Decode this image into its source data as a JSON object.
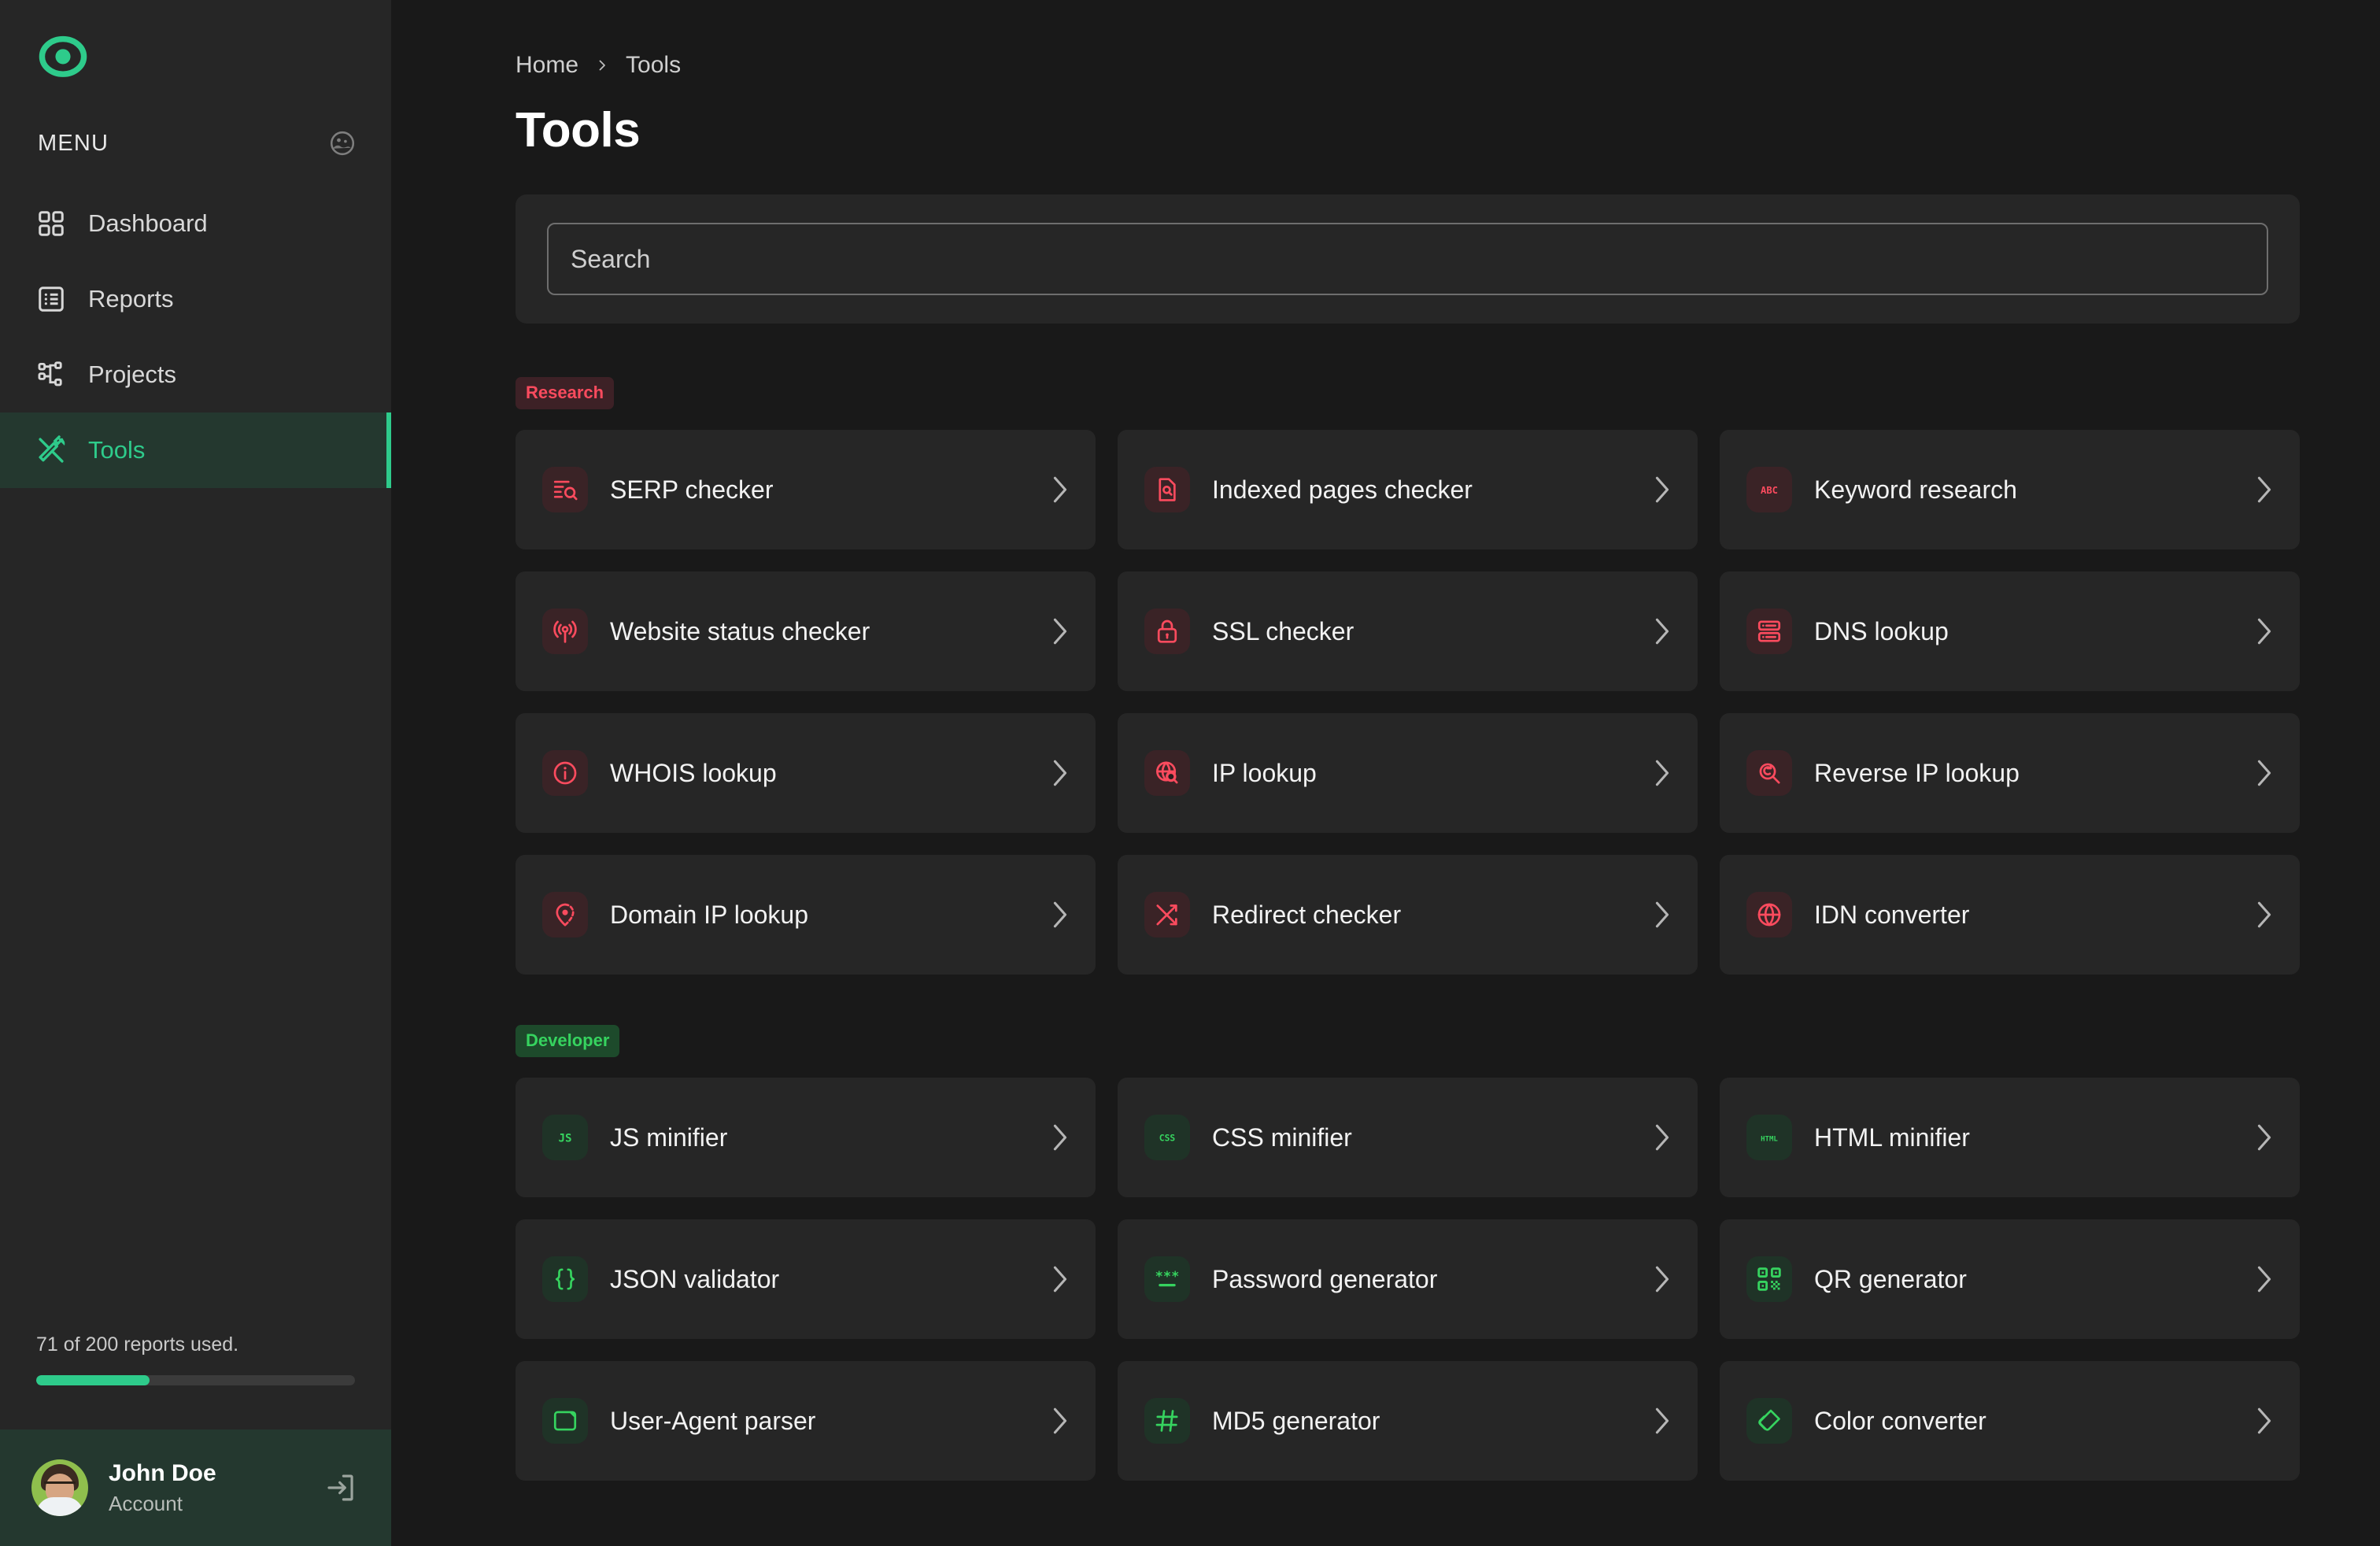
{
  "brand": {
    "logo_icon": "target-circle-logo"
  },
  "sidebar": {
    "menu_label": "MENU",
    "theme_icon": "color-palette-icon",
    "items": [
      {
        "label": "Dashboard",
        "icon": "grid-dashboard-icon",
        "active": false
      },
      {
        "label": "Reports",
        "icon": "list-report-icon",
        "active": false
      },
      {
        "label": "Projects",
        "icon": "sitemap-projects-icon",
        "active": false
      },
      {
        "label": "Tools",
        "icon": "hammer-wrench-tools-icon",
        "active": true
      }
    ],
    "usage": {
      "text": "71 of 200 reports used.",
      "used": 71,
      "total": 200,
      "percent": 35.5,
      "fill_color": "#2ecb8b"
    },
    "account": {
      "name": "John Doe",
      "subtitle": "Account",
      "avatar_icon": "user-avatar-photo",
      "logout_icon": "logout-arrow-icon"
    }
  },
  "breadcrumb": {
    "home": "Home",
    "separator_icon": "chevron-right-icon",
    "current": "Tools"
  },
  "header": {
    "title": "Tools"
  },
  "search": {
    "placeholder": "Search",
    "value": ""
  },
  "sections": [
    {
      "badge": "Research",
      "badge_bg": "#3d2126",
      "badge_color": "#fb4b5e",
      "accent": "red",
      "tools": [
        {
          "label": "SERP checker",
          "icon": "serp-list-search-icon"
        },
        {
          "label": "Indexed pages checker",
          "icon": "document-search-icon"
        },
        {
          "label": "Keyword research",
          "icon": "abc-keyword-icon"
        },
        {
          "label": "Website status checker",
          "icon": "broadcast-signal-icon"
        },
        {
          "label": "SSL checker",
          "icon": "lock-icon"
        },
        {
          "label": "DNS lookup",
          "icon": "server-rack-icon"
        },
        {
          "label": "WHOIS lookup",
          "icon": "info-circle-icon"
        },
        {
          "label": "IP lookup",
          "icon": "globe-search-icon"
        },
        {
          "label": "Reverse IP lookup",
          "icon": "magnifier-reverse-icon"
        },
        {
          "label": "Domain IP lookup",
          "icon": "location-target-icon"
        },
        {
          "label": "Redirect checker",
          "icon": "shuffle-arrows-icon"
        },
        {
          "label": "IDN converter",
          "icon": "globe-icon"
        }
      ]
    },
    {
      "badge": "Developer",
      "badge_bg": "#1d4a2b",
      "badge_color": "#36d35f",
      "accent": "green",
      "tools": [
        {
          "label": "JS minifier",
          "icon": "js-text-icon"
        },
        {
          "label": "CSS minifier",
          "icon": "css-text-icon"
        },
        {
          "label": "HTML minifier",
          "icon": "html-text-icon"
        },
        {
          "label": "JSON validator",
          "icon": "curly-braces-icon"
        },
        {
          "label": "Password generator",
          "icon": "asterisk-password-icon"
        },
        {
          "label": "QR generator",
          "icon": "qr-code-icon"
        },
        {
          "label": "User-Agent parser",
          "icon": "browser-window-icon"
        },
        {
          "label": "MD5 generator",
          "icon": "hash-icon"
        },
        {
          "label": "Color converter",
          "icon": "color-swatch-icon"
        }
      ]
    }
  ],
  "colors": {
    "app_bg": "#191919",
    "panel_bg": "#262626",
    "accent_green": "#2ecb8b",
    "accent_red": "#fb4b5e",
    "dev_green": "#36d35f"
  }
}
